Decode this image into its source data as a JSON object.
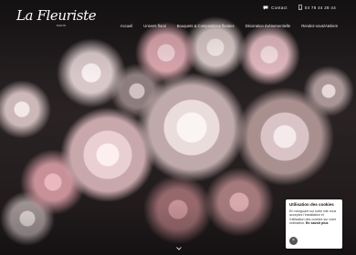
{
  "logo": {
    "text": "La Fleuriste",
    "sub": "PARIS"
  },
  "topbar": {
    "contact": "Contact",
    "phone": "04 78 44 28 44"
  },
  "nav": [
    "Accueil",
    "Univers floral",
    "Bouquets & Compositions florales",
    "Décoration événementielle",
    "Rendez-vous/Ateliers"
  ],
  "cookie": {
    "title": "Utilisation des cookies",
    "body": "En naviguant sur notre site vous acceptez l'installation et l'utilisation des cookies sur votre ordinateur.",
    "link": "En savoir plus",
    "close": "×"
  },
  "colors": {
    "accent": "#ffffff",
    "background": "#1a1718"
  },
  "icons": {
    "contact": "chat-icon",
    "phone": "phone-icon",
    "scroll": "chevron-down-icon"
  }
}
